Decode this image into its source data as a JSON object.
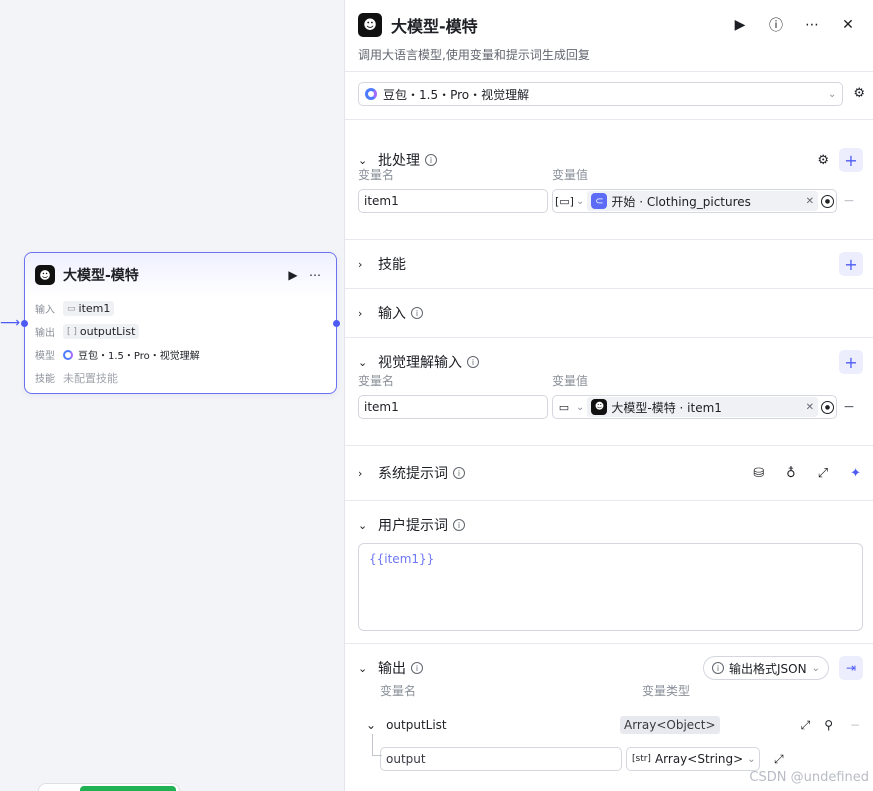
{
  "node": {
    "title": "大模型-模特",
    "rows": [
      {
        "key": "输入",
        "value": "item1",
        "icon": "image-icon"
      },
      {
        "key": "输出",
        "value": "outputList",
        "icon": "array-icon"
      },
      {
        "key": "模型",
        "value": "豆包・1.5・Pro・视觉理解",
        "icon": "doubao-icon"
      },
      {
        "key": "技能",
        "value": "未配置技能"
      }
    ]
  },
  "panel": {
    "title": "大模型-模特",
    "description": "调用大语言模型,使用变量和提示词生成回复",
    "model": "豆包・1.5・Pro・视觉理解",
    "batch": {
      "title": "批处理",
      "col_name": "变量名",
      "col_value": "变量值",
      "row": {
        "name": "item1",
        "source": "开始 · Clothing_pictures"
      }
    },
    "skills": {
      "title": "技能"
    },
    "input": {
      "title": "输入"
    },
    "vision": {
      "title": "视觉理解输入",
      "col_name": "变量名",
      "col_value": "变量值",
      "row": {
        "name": "item1",
        "source": "大模型-模特 · item1"
      }
    },
    "system_prompt": {
      "title": "系统提示词"
    },
    "user_prompt": {
      "title": "用户提示词",
      "content": "{{item1}}"
    },
    "output": {
      "title": "输出",
      "format_label": "输出格式JSON",
      "col_name": "变量名",
      "col_type": "变量类型",
      "item": {
        "name": "outputList",
        "type": "Array<Object>"
      },
      "child": {
        "name": "output",
        "type": "Array<String>"
      }
    }
  },
  "watermark": "CSDN @undefined",
  "colors": {
    "accent": "#4e5bf2",
    "accent_bg": "#eceefe",
    "success": "#20b153"
  }
}
